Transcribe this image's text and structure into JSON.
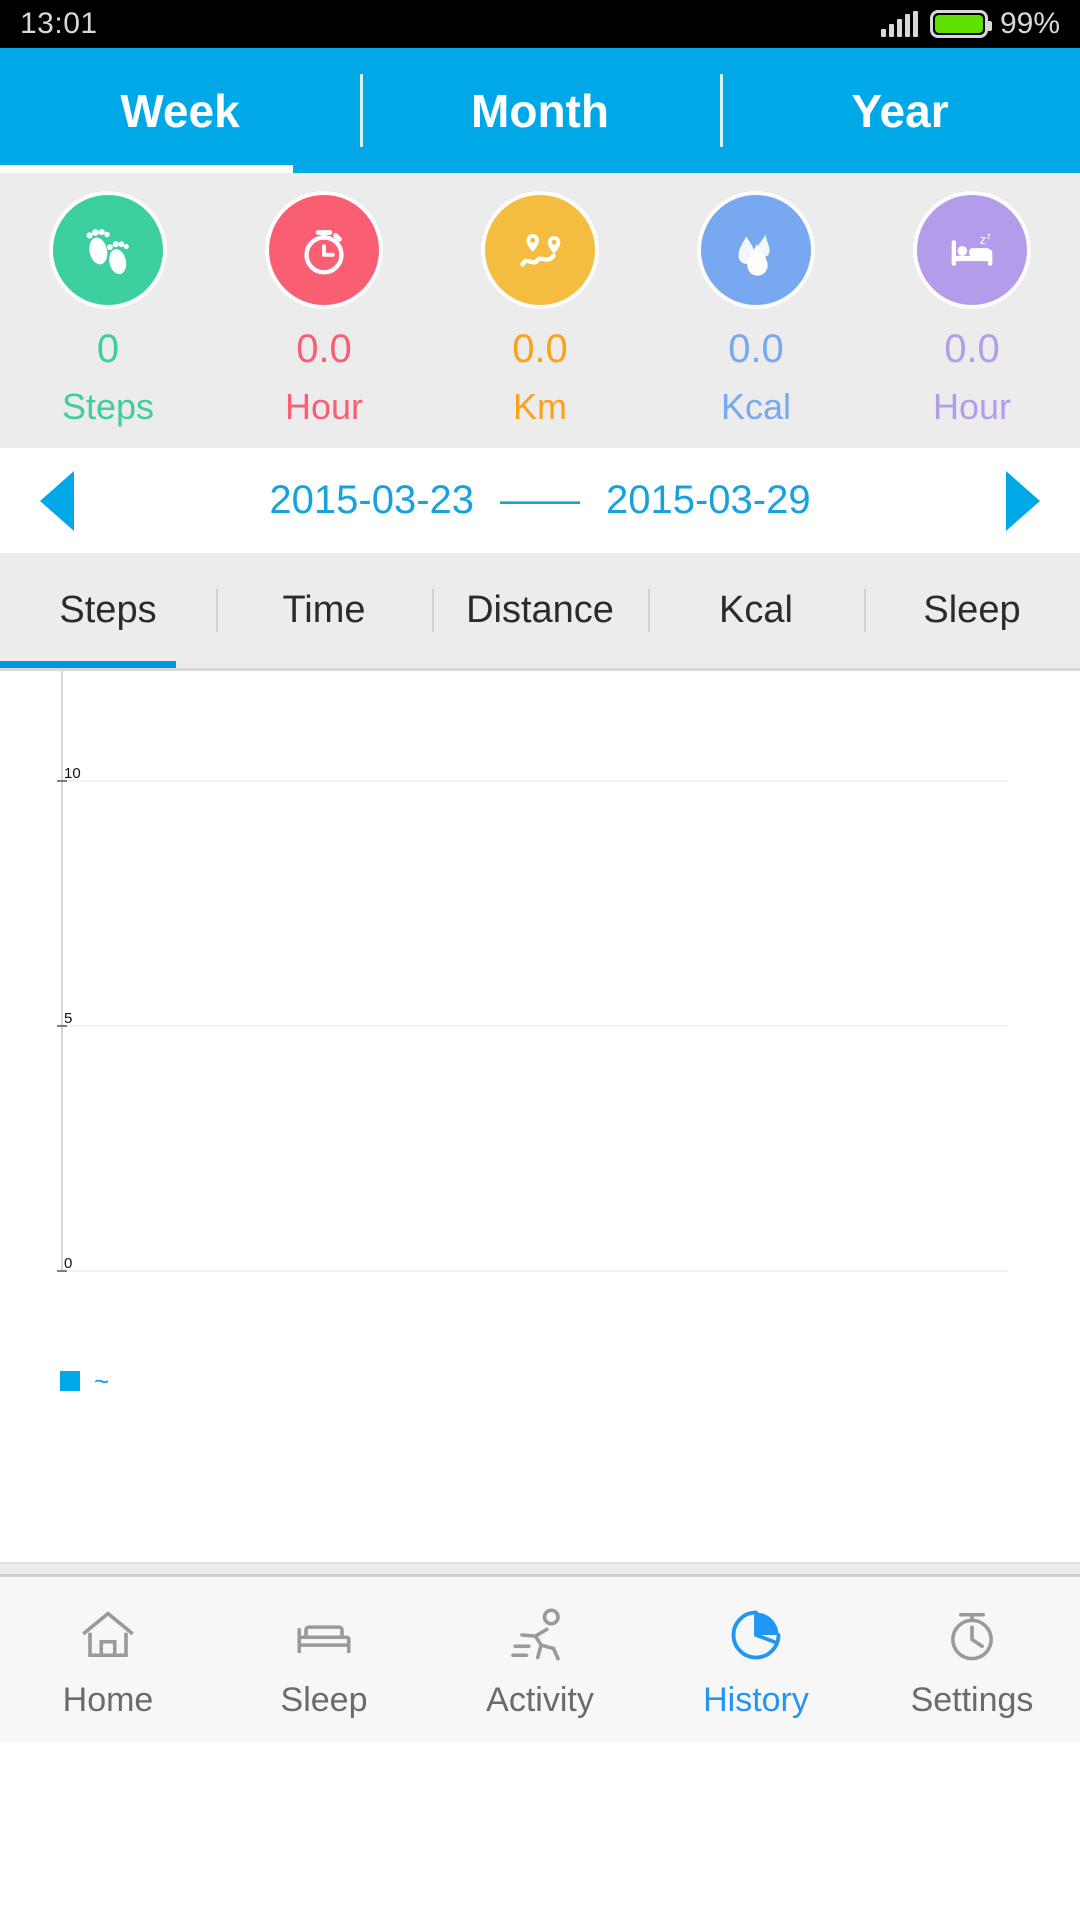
{
  "status_bar": {
    "time": "13:01",
    "battery_percent": "99%",
    "signal_icon": "signal-bars-icon",
    "battery_icon": "battery-icon",
    "battery_color": "#5ee000"
  },
  "period_tabs": {
    "items": [
      {
        "label": "Week",
        "active": true
      },
      {
        "label": "Month",
        "active": false
      },
      {
        "label": "Year",
        "active": false
      }
    ],
    "bar_color": "#00A8E8",
    "indicator_color": "#ffffff"
  },
  "summary": {
    "metrics": [
      {
        "icon": "footprints-icon",
        "value": "0",
        "label": "Steps",
        "color": "#3ECFA0"
      },
      {
        "icon": "stopwatch-icon",
        "value": "0.0",
        "label": "Hour",
        "color": "#FA5E72"
      },
      {
        "icon": "route-map-icon",
        "value": "0.0",
        "label": "Km",
        "color": "#F5BD3F",
        "value_color": "#FAA21B"
      },
      {
        "icon": "flame-drop-icon",
        "value": "0.0",
        "label": "Kcal",
        "color": "#78A8F0"
      },
      {
        "icon": "bed-sleep-icon",
        "value": "0.0",
        "label": "Hour",
        "color": "#B39DEB"
      }
    ]
  },
  "date_range": {
    "start": "2015-03-23",
    "separator": "——",
    "end": "2015-03-29",
    "prev_icon": "arrow-left-icon",
    "next_icon": "arrow-right-icon",
    "color": "#18A2DC"
  },
  "sub_tabs": {
    "items": [
      {
        "label": "Steps",
        "active": true
      },
      {
        "label": "Time",
        "active": false
      },
      {
        "label": "Distance",
        "active": false
      },
      {
        "label": "Kcal",
        "active": false
      },
      {
        "label": "Sleep",
        "active": false
      }
    ],
    "indicator_color": "#0099DD"
  },
  "chart_data": {
    "type": "bar",
    "title": "",
    "xlabel": "",
    "ylabel": "",
    "categories": [
      "",
      "",
      "",
      "",
      "",
      "",
      ""
    ],
    "values": [
      0,
      0,
      0,
      0,
      0,
      0,
      0
    ],
    "yticks": [
      "0",
      "5",
      "10"
    ],
    "ytick_values": [
      0,
      5,
      10
    ],
    "ylim": [
      0,
      10
    ],
    "grid": true,
    "legend": {
      "position": "bottom-left",
      "entries": [
        {
          "label": "~",
          "color": "#00A8E8"
        }
      ]
    },
    "series_color": "#00A8E8",
    "axis_color": "#d6d6d6"
  },
  "bottom_nav": {
    "items": [
      {
        "label": "Home",
        "icon": "home-icon",
        "active": false
      },
      {
        "label": "Sleep",
        "icon": "bed-icon",
        "active": false
      },
      {
        "label": "Activity",
        "icon": "runner-icon",
        "active": false
      },
      {
        "label": "History",
        "icon": "pie-clock-icon",
        "active": true
      },
      {
        "label": "Settings",
        "icon": "stopwatch-outline-icon",
        "active": false
      }
    ],
    "active_color": "#2196F3",
    "inactive_color": "#6b6b6b"
  }
}
